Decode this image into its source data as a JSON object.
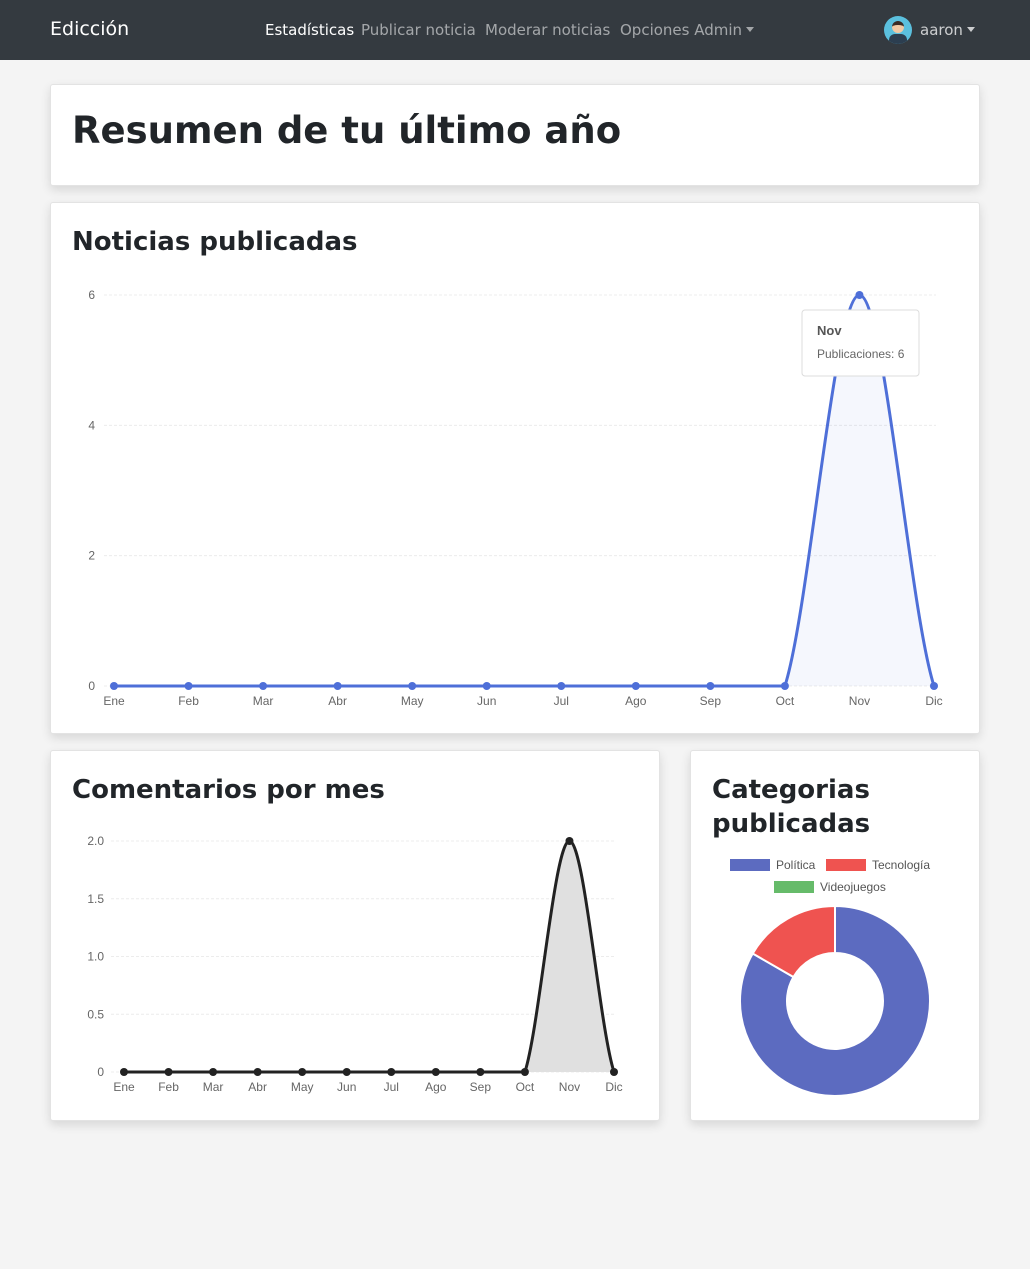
{
  "navbar": {
    "brand": "Edicción",
    "links": [
      "Estadísticas",
      "Publicar noticia",
      "Moderar noticias",
      "Opciones Admin"
    ],
    "user": "aaron"
  },
  "summary": {
    "title": "Resumen de tu último año"
  },
  "cards": {
    "news_title": "Noticias publicadas",
    "comments_title": "Comentarios por mes",
    "categories_title_line1": "Categorias",
    "categories_title_line2": "publicadas"
  },
  "tooltip": {
    "title": "Nov",
    "text": "Publicaciones: 6"
  },
  "colors": {
    "news_line": "#4e6fd8",
    "comments_line": "#222222",
    "politica": "#5c6bc0",
    "tecnologia": "#ef5350",
    "videojuegos": "#66bb6a"
  },
  "chart_data": [
    {
      "type": "line",
      "categories": [
        "Ene",
        "Feb",
        "Mar",
        "Abr",
        "May",
        "Jun",
        "Jul",
        "Ago",
        "Sep",
        "Oct",
        "Nov",
        "Dic"
      ],
      "series": [
        {
          "name": "Publicaciones",
          "values": [
            0,
            0,
            0,
            0,
            0,
            0,
            0,
            0,
            0,
            0,
            6,
            0
          ]
        }
      ],
      "yticks": [
        "0",
        "2",
        "4",
        "6"
      ],
      "ylim": [
        0,
        6
      ],
      "grid": true
    },
    {
      "type": "line",
      "categories": [
        "Ene",
        "Feb",
        "Mar",
        "Abr",
        "May",
        "Jun",
        "Jul",
        "Ago",
        "Sep",
        "Oct",
        "Nov",
        "Dic"
      ],
      "series": [
        {
          "values": [
            0,
            0,
            0,
            0,
            0,
            0,
            0,
            0,
            0,
            0,
            2,
            0
          ]
        }
      ],
      "yticks": [
        "0",
        "0.5",
        "1.0",
        "1.5",
        "2.0"
      ],
      "ylim": [
        0,
        2
      ],
      "grid": true
    },
    {
      "type": "pie",
      "categories": [
        "Política",
        "Tecnología",
        "Videojuegos"
      ],
      "values": [
        5,
        1,
        0
      ],
      "legend": "top"
    }
  ]
}
